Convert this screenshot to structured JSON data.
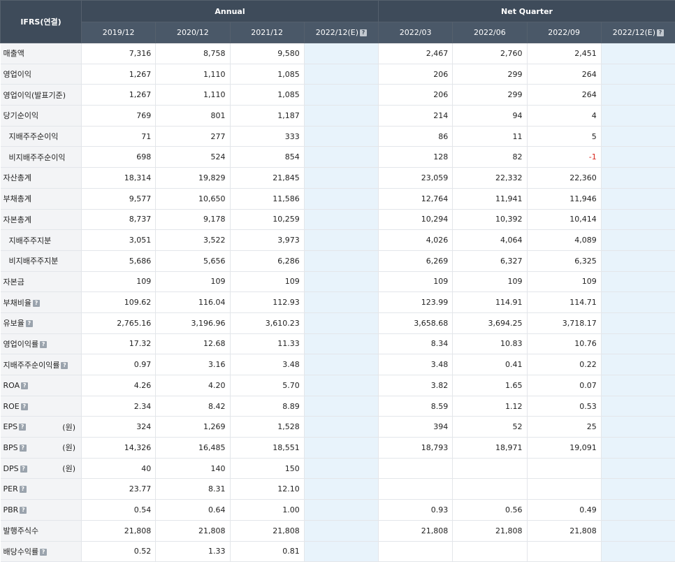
{
  "header": {
    "corner": "IFRS(연결)",
    "annual_label": "Annual",
    "quarter_label": "Net Quarter",
    "annual_periods": [
      "2019/12",
      "2020/12",
      "2021/12",
      "2022/12(E)"
    ],
    "quarter_periods": [
      "2022/03",
      "2022/06",
      "2022/09",
      "2022/12(E)"
    ],
    "estimate_badge": "?"
  },
  "rows": [
    {
      "label": "매출액",
      "indent": false,
      "info": false,
      "unit": "",
      "values": [
        "7,316",
        "8,758",
        "9,580",
        "",
        "2,467",
        "2,760",
        "2,451",
        ""
      ]
    },
    {
      "label": "영업이익",
      "indent": false,
      "info": false,
      "unit": "",
      "values": [
        "1,267",
        "1,110",
        "1,085",
        "",
        "206",
        "299",
        "264",
        ""
      ]
    },
    {
      "label": "영업이익(발표기준)",
      "indent": false,
      "info": false,
      "unit": "",
      "values": [
        "1,267",
        "1,110",
        "1,085",
        "",
        "206",
        "299",
        "264",
        ""
      ]
    },
    {
      "label": "당기순이익",
      "indent": false,
      "info": false,
      "unit": "",
      "values": [
        "769",
        "801",
        "1,187",
        "",
        "214",
        "94",
        "4",
        ""
      ]
    },
    {
      "label": "지배주주순이익",
      "indent": true,
      "info": false,
      "unit": "",
      "values": [
        "71",
        "277",
        "333",
        "",
        "86",
        "11",
        "5",
        ""
      ]
    },
    {
      "label": "비지배주주순이익",
      "indent": true,
      "info": false,
      "unit": "",
      "values": [
        "698",
        "524",
        "854",
        "",
        "128",
        "82",
        "-1",
        ""
      ]
    },
    {
      "label": "자산총계",
      "indent": false,
      "info": false,
      "unit": "",
      "values": [
        "18,314",
        "19,829",
        "21,845",
        "",
        "23,059",
        "22,332",
        "22,360",
        ""
      ]
    },
    {
      "label": "부채총계",
      "indent": false,
      "info": false,
      "unit": "",
      "values": [
        "9,577",
        "10,650",
        "11,586",
        "",
        "12,764",
        "11,941",
        "11,946",
        ""
      ]
    },
    {
      "label": "자본총계",
      "indent": false,
      "info": false,
      "unit": "",
      "values": [
        "8,737",
        "9,178",
        "10,259",
        "",
        "10,294",
        "10,392",
        "10,414",
        ""
      ]
    },
    {
      "label": "지배주주지분",
      "indent": true,
      "info": false,
      "unit": "",
      "values": [
        "3,051",
        "3,522",
        "3,973",
        "",
        "4,026",
        "4,064",
        "4,089",
        ""
      ]
    },
    {
      "label": "비지배주주지분",
      "indent": true,
      "info": false,
      "unit": "",
      "values": [
        "5,686",
        "5,656",
        "6,286",
        "",
        "6,269",
        "6,327",
        "6,325",
        ""
      ]
    },
    {
      "label": "자본금",
      "indent": false,
      "info": false,
      "unit": "",
      "values": [
        "109",
        "109",
        "109",
        "",
        "109",
        "109",
        "109",
        ""
      ]
    },
    {
      "label": "부채비율",
      "indent": false,
      "info": true,
      "unit": "",
      "values": [
        "109.62",
        "116.04",
        "112.93",
        "",
        "123.99",
        "114.91",
        "114.71",
        ""
      ]
    },
    {
      "label": "유보율",
      "indent": false,
      "info": true,
      "unit": "",
      "values": [
        "2,765.16",
        "3,196.96",
        "3,610.23",
        "",
        "3,658.68",
        "3,694.25",
        "3,718.17",
        ""
      ]
    },
    {
      "label": "영업이익률",
      "indent": false,
      "info": true,
      "unit": "",
      "values": [
        "17.32",
        "12.68",
        "11.33",
        "",
        "8.34",
        "10.83",
        "10.76",
        ""
      ]
    },
    {
      "label": "지배주주순이익률",
      "indent": false,
      "info": true,
      "unit": "",
      "values": [
        "0.97",
        "3.16",
        "3.48",
        "",
        "3.48",
        "0.41",
        "0.22",
        ""
      ]
    },
    {
      "label": "ROA",
      "indent": false,
      "info": true,
      "unit": "",
      "values": [
        "4.26",
        "4.20",
        "5.70",
        "",
        "3.82",
        "1.65",
        "0.07",
        ""
      ]
    },
    {
      "label": "ROE",
      "indent": false,
      "info": true,
      "unit": "",
      "values": [
        "2.34",
        "8.42",
        "8.89",
        "",
        "8.59",
        "1.12",
        "0.53",
        ""
      ]
    },
    {
      "label": "EPS",
      "indent": false,
      "info": true,
      "unit": "(원)",
      "values": [
        "324",
        "1,269",
        "1,528",
        "",
        "394",
        "52",
        "25",
        ""
      ]
    },
    {
      "label": "BPS",
      "indent": false,
      "info": true,
      "unit": "(원)",
      "values": [
        "14,326",
        "16,485",
        "18,551",
        "",
        "18,793",
        "18,971",
        "19,091",
        ""
      ]
    },
    {
      "label": "DPS",
      "indent": false,
      "info": true,
      "unit": "(원)",
      "values": [
        "40",
        "140",
        "150",
        "",
        "",
        "",
        "",
        ""
      ]
    },
    {
      "label": "PER",
      "indent": false,
      "info": true,
      "unit": "",
      "values": [
        "23.77",
        "8.31",
        "12.10",
        "",
        "",
        "",
        "",
        ""
      ]
    },
    {
      "label": "PBR",
      "indent": false,
      "info": true,
      "unit": "",
      "values": [
        "0.54",
        "0.64",
        "1.00",
        "",
        "0.93",
        "0.56",
        "0.49",
        ""
      ]
    },
    {
      "label": "발행주식수",
      "indent": false,
      "info": false,
      "unit": "",
      "values": [
        "21,808",
        "21,808",
        "21,808",
        "",
        "21,808",
        "21,808",
        "21,808",
        ""
      ]
    },
    {
      "label": "배당수익률",
      "indent": false,
      "info": true,
      "unit": "",
      "values": [
        "0.52",
        "1.33",
        "0.81",
        "",
        "",
        "",
        "",
        ""
      ]
    }
  ],
  "colors": {
    "header_bg": "#3e4b5a",
    "estimate_bg": "#e8f3fb",
    "label_bg": "#f3f4f6",
    "negative": "#d8261d"
  }
}
